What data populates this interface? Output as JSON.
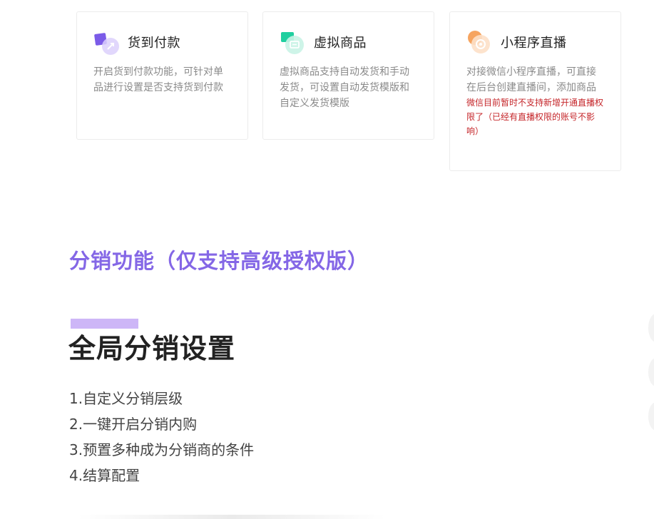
{
  "cards": [
    {
      "title": "货到付款",
      "icon": "cod-icon",
      "description": "开启货到付款功能，可针对单品进行设置是否支持货到付款"
    },
    {
      "title": "虚拟商品",
      "icon": "virtual-goods-icon",
      "description": "虚拟商品支持自动发货和手动发货，可设置自动发货模版和自定义发货模版"
    },
    {
      "title": "小程序直播",
      "icon": "live-stream-icon",
      "description": "对接微信小程序直播，可直接在后台创建直播间，添加商品",
      "warning": "微信目前暂时不支持新增开通直播权限了（已经有直播权限的账号不影响）"
    }
  ],
  "distribution": {
    "heading": "分销功能（仅支持高级授权版）",
    "feature_title": "全局分销设置",
    "features": [
      "1.自定义分销层级",
      "2.一键开启分销内购",
      "3.预置多种成为分销商的条件",
      "4.结算配置"
    ]
  },
  "colors": {
    "heading": "#8467e6",
    "accent_bar": "#cdb6f7",
    "warning": "#c5262a"
  }
}
